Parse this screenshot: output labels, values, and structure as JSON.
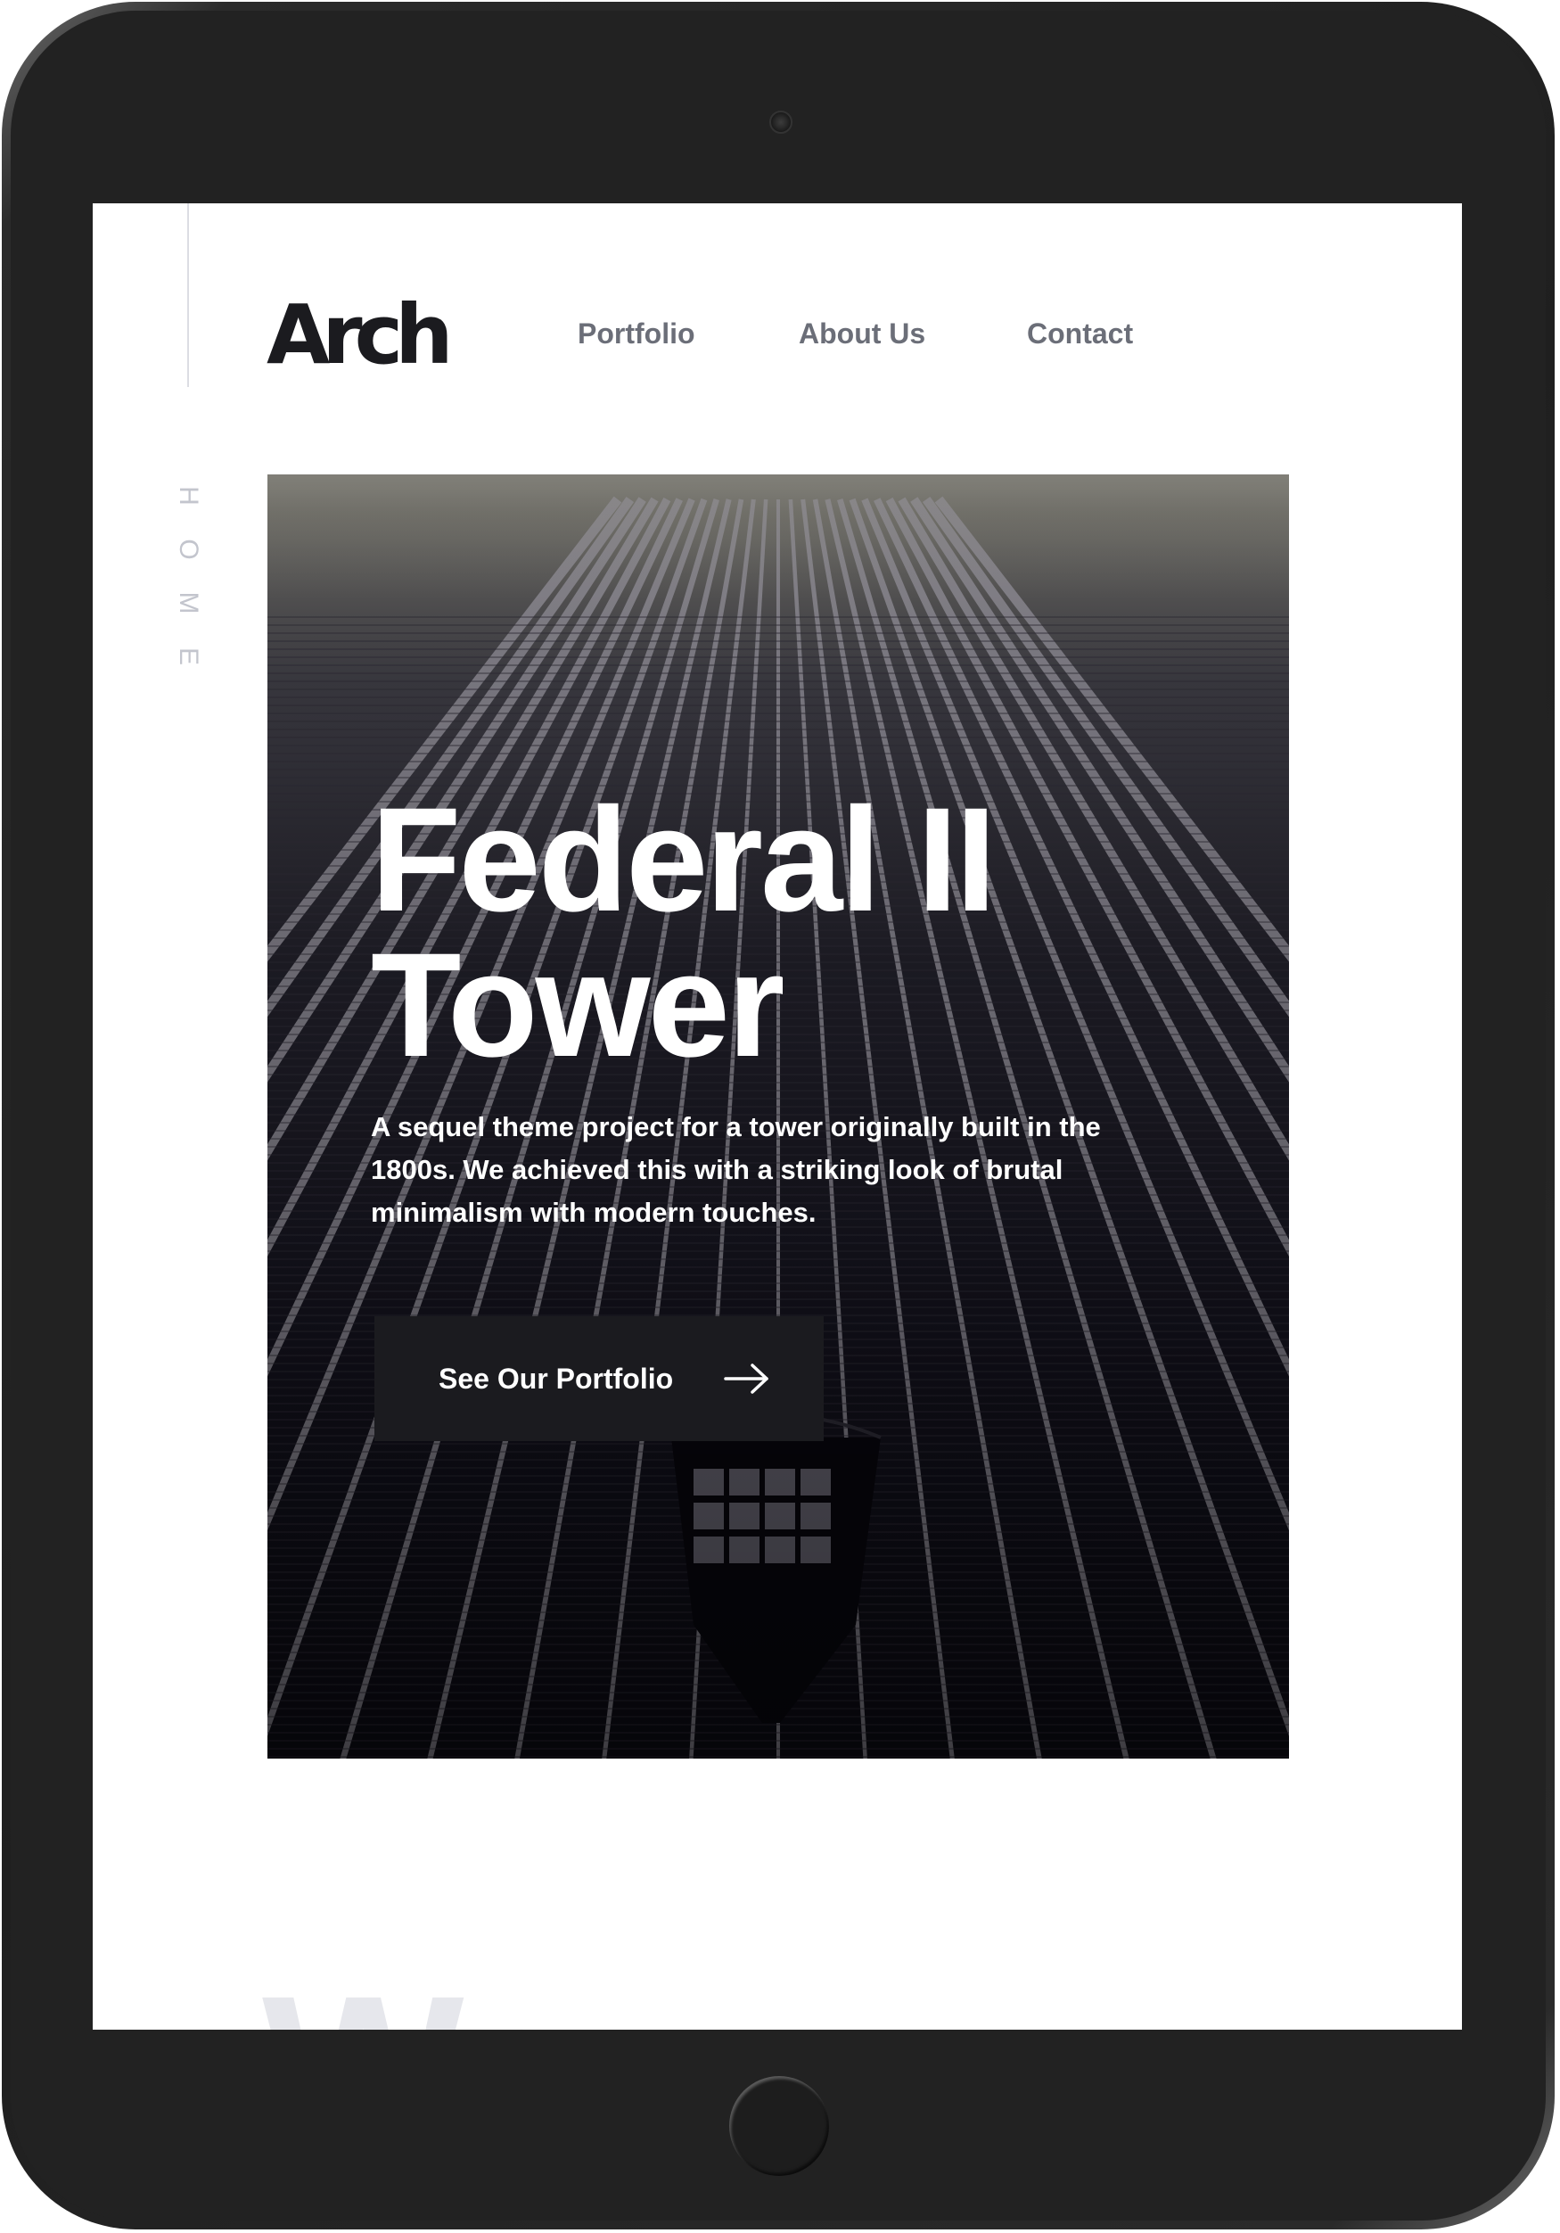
{
  "brand": {
    "logo": "Arch"
  },
  "sidebar": {
    "section_label": "HOME"
  },
  "nav": {
    "items": [
      {
        "label": "Portfolio"
      },
      {
        "label": "About Us"
      },
      {
        "label": "Contact"
      }
    ]
  },
  "hero": {
    "title_line_1": "Federal II",
    "title_line_2": "Tower",
    "description": "A sequel theme project for a tower originally built in the 1800s. We achieved this with a striking look of brutal minimalism with modern touches.",
    "cta_label": "See Our Portfolio",
    "cta_icon": "arrow-right-icon"
  },
  "next_section": {
    "background_word": "We"
  },
  "colors": {
    "text_dark": "#1b1b1f",
    "nav_text": "#6b6e78",
    "side_label": "#c3c5cd",
    "cta_background": "#1b1b1f",
    "device_frame": "#222222"
  }
}
